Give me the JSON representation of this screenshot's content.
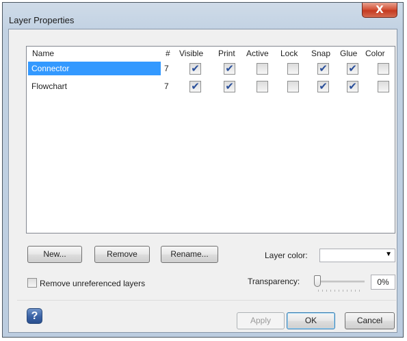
{
  "window": {
    "title": "Layer Properties",
    "close_glyph": "X"
  },
  "columns": [
    "Name",
    "#",
    "Visible",
    "Print",
    "Active",
    "Lock",
    "Snap",
    "Glue",
    "Color"
  ],
  "layers": [
    {
      "name": "Connector",
      "count": "7",
      "selected": true,
      "visible": true,
      "print": true,
      "active": false,
      "lock": false,
      "snap": true,
      "glue": true,
      "color": false
    },
    {
      "name": "Flowchart",
      "count": "7",
      "selected": false,
      "visible": true,
      "print": true,
      "active": false,
      "lock": false,
      "snap": true,
      "glue": true,
      "color": false
    }
  ],
  "buttons": {
    "new": "New...",
    "remove": "Remove",
    "rename": "Rename...",
    "apply": "Apply",
    "ok": "OK",
    "cancel": "Cancel"
  },
  "layer_color": {
    "label": "Layer color:",
    "value": ""
  },
  "remove_unreferenced": {
    "label": "Remove unreferenced layers",
    "checked": false
  },
  "transparency": {
    "label": "Transparency:",
    "value": "0%"
  },
  "help_glyph": "?",
  "check_glyph": "✔",
  "colors": {
    "selection": "#3399ff",
    "check": "#2a4f9a",
    "close": "#c43a20"
  }
}
